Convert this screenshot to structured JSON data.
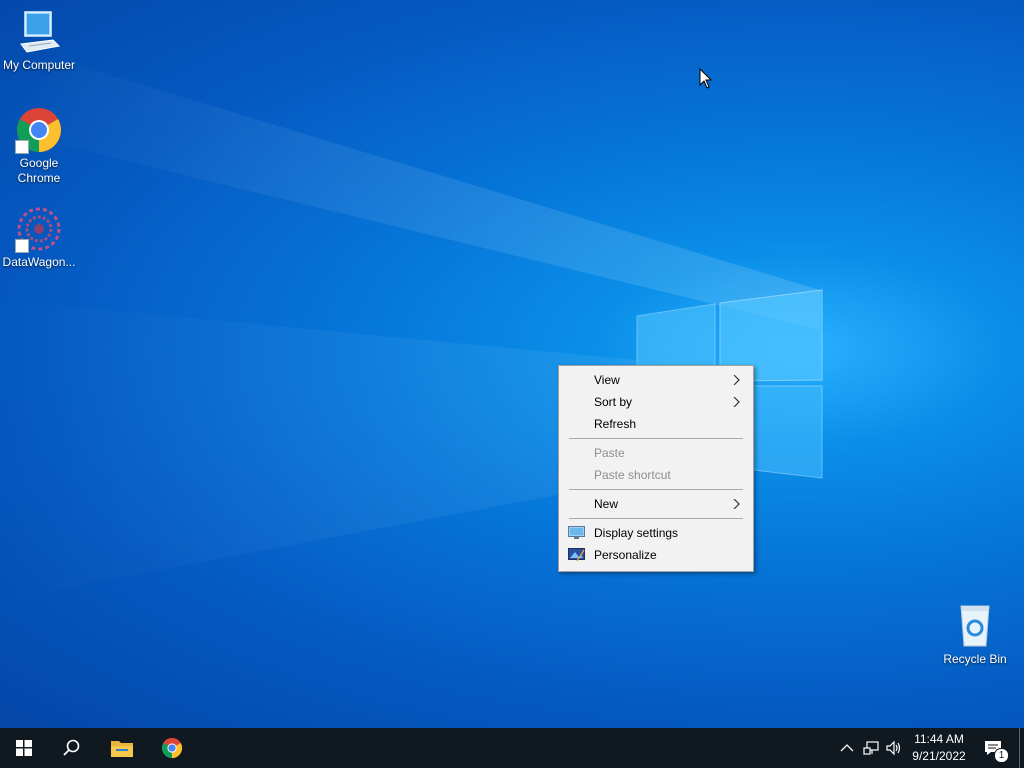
{
  "desktop": {
    "icons": [
      {
        "label": "My Computer"
      },
      {
        "label": "Google Chrome"
      },
      {
        "label": "DataWagon..."
      },
      {
        "label": "Recycle Bin"
      }
    ]
  },
  "context_menu": {
    "items": [
      {
        "label": "View",
        "submenu": true,
        "enabled": true
      },
      {
        "label": "Sort by",
        "submenu": true,
        "enabled": true
      },
      {
        "label": "Refresh",
        "submenu": false,
        "enabled": true
      },
      {
        "label": "Paste",
        "submenu": false,
        "enabled": false
      },
      {
        "label": "Paste shortcut",
        "submenu": false,
        "enabled": false
      },
      {
        "label": "New",
        "submenu": true,
        "enabled": true
      },
      {
        "label": "Display settings",
        "icon": "display-settings-icon",
        "enabled": true
      },
      {
        "label": "Personalize",
        "icon": "personalize-icon",
        "enabled": true
      }
    ]
  },
  "taskbar": {
    "buttons": [
      {
        "icon": "windows-start-icon"
      },
      {
        "icon": "search-icon"
      },
      {
        "icon": "file-explorer-icon"
      },
      {
        "icon": "chrome-icon"
      }
    ],
    "tray": {
      "icons": [
        "chevron-up-icon",
        "network-icon",
        "volume-icon"
      ],
      "time": "11:44 AM",
      "date": "9/21/2022",
      "notification_count": "1"
    }
  },
  "colors": {
    "taskbar": "#101820",
    "menu_bg": "#f2f2f2",
    "desktop_accent": "#0a8fe8"
  }
}
